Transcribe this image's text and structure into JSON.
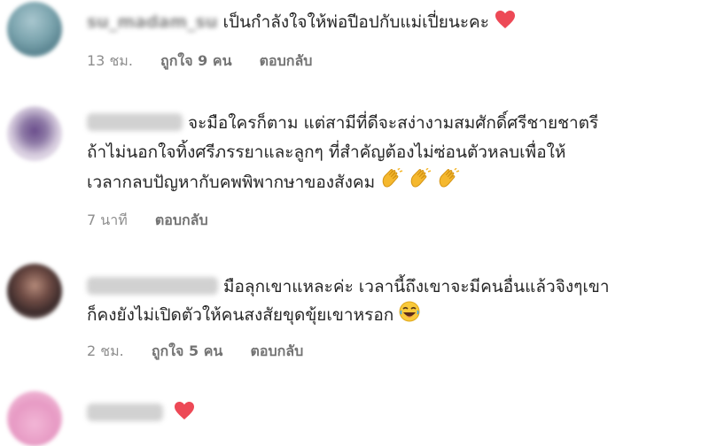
{
  "comments": [
    {
      "username": "su_madam_su",
      "text_lines": [
        "เป็นกำลังใจให้พ่อปีอปกับแม่เปี่ยนะคะ"
      ],
      "emojis": [
        "red-heart"
      ],
      "time": "13 ชม.",
      "likes": "ถูกใจ 9 คน",
      "reply": "ตอบกลับ"
    },
    {
      "username": "",
      "text_lines": [
        "จะมือใครก็ตาม แต่สามีที่ดีจะสง่างามสมศักดิ์ศรีชายชาตรี",
        "ถ้าไม่นอกใจทิ้งศรีภรรยาและลูกๆ ที่สำคัญต้องไม่ซ่อนตัวหลบเพื่อให้",
        "เวลากลบปัญหากับคพพิพากษาของสังคม"
      ],
      "emojis": [
        "clapping-hands",
        "clapping-hands",
        "clapping-hands"
      ],
      "time": "7 นาที",
      "reply": "ตอบกลับ"
    },
    {
      "username": "",
      "text_lines": [
        "มือลุกเขาแหละค่ะ เวลานี้ถึงเขาจะมีคนอื่นแล้วจิงๆเขา",
        "ก็คงยังไม่เปิดตัวให้คนสงสัยขุดขุ้ยเขาหรอก"
      ],
      "emojis": [
        "laughing-face"
      ],
      "time": "2 ชม.",
      "likes": "ถูกใจ 5 คน",
      "reply": "ตอบกลับ"
    },
    {
      "username": "",
      "emojis": [
        "red-heart"
      ]
    }
  ],
  "colors": {
    "text": "#262626",
    "meta": "#8e8e8e",
    "heart": "#ed4956",
    "clap": "#f5b82e"
  }
}
